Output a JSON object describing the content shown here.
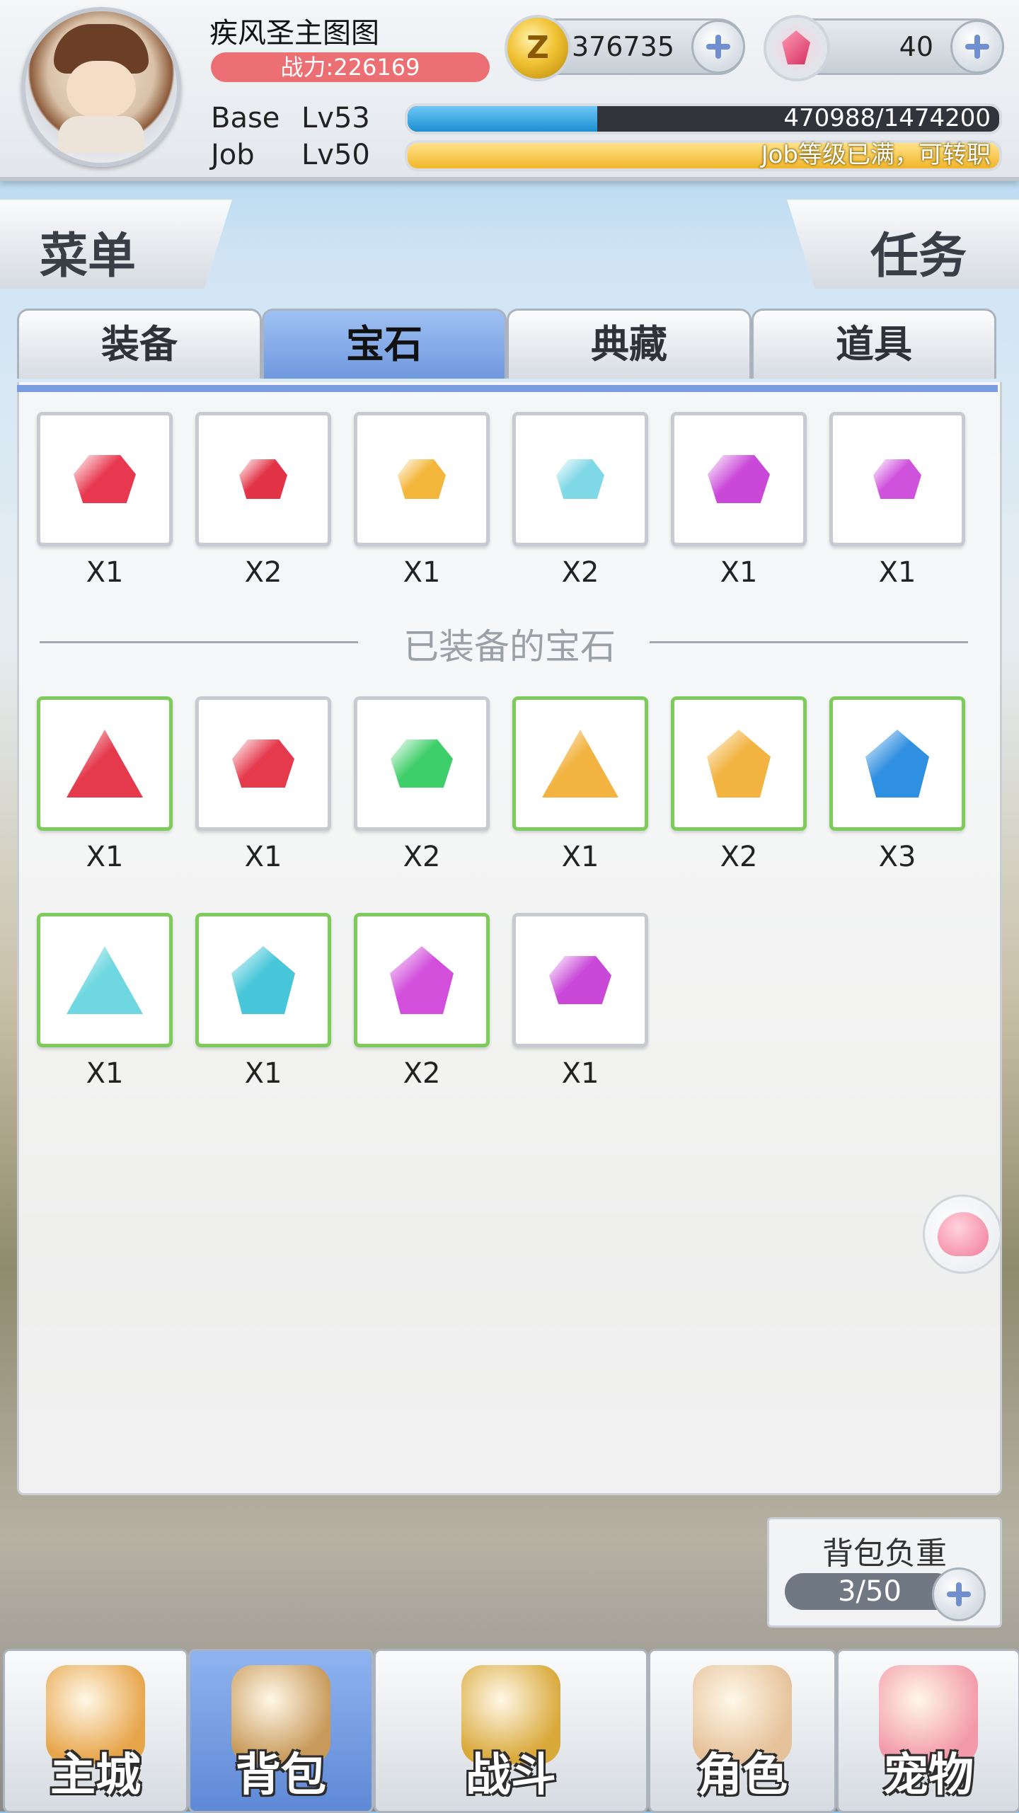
{
  "player": {
    "name": "疾风圣主图图",
    "power": "战力:226169",
    "base_label": "Base",
    "base_level": "Lv53",
    "base_exp": "470988/1474200",
    "base_progress": 0.32,
    "job_label": "Job",
    "job_level": "Lv50",
    "job_status": "Job等级已满，可转职",
    "job_progress": 1.0
  },
  "currency": {
    "zeny_icon_text": "Z",
    "zeny": "376735",
    "gems": "40"
  },
  "buttons": {
    "menu": "菜单",
    "tasks": "任务"
  },
  "tabs": [
    "装备",
    "宝石",
    "典藏",
    "道具"
  ],
  "active_tab": "宝石",
  "inventory_gems": [
    {
      "shape": "oval",
      "color": "#e8384f",
      "count": "X1"
    },
    {
      "shape": "oval-small",
      "color": "#e23446",
      "count": "X2"
    },
    {
      "shape": "oval-small",
      "color": "#f3b63a",
      "count": "X1"
    },
    {
      "shape": "oval-small",
      "color": "#7fd8e6",
      "count": "X2"
    },
    {
      "shape": "oval",
      "color": "#c948d8",
      "count": "X1"
    },
    {
      "shape": "oval-small",
      "color": "#cf52dd",
      "count": "X1"
    }
  ],
  "divider_label": "已装备的宝石",
  "equipped_gems": [
    {
      "shape": "tri",
      "color": "#e53a4c",
      "count": "X1",
      "equipped": true
    },
    {
      "shape": "oval",
      "color": "#e53a4c",
      "count": "X1",
      "equipped": false
    },
    {
      "shape": "oval",
      "color": "#3fcf6a",
      "count": "X2",
      "equipped": false
    },
    {
      "shape": "tri",
      "color": "#f2b340",
      "count": "X1",
      "equipped": true
    },
    {
      "shape": "tri-round",
      "color": "#f2b340",
      "count": "X2",
      "equipped": true
    },
    {
      "shape": "tri-round",
      "color": "#2f8fe0",
      "count": "X3",
      "equipped": true
    },
    {
      "shape": "tri",
      "color": "#6fd7e0",
      "count": "X1",
      "equipped": true
    },
    {
      "shape": "tri-round",
      "color": "#46c6d8",
      "count": "X1",
      "equipped": true
    },
    {
      "shape": "tri-round",
      "color": "#d24fdc",
      "count": "X2",
      "equipped": true
    },
    {
      "shape": "oval",
      "color": "#c948d8",
      "count": "X1",
      "equipped": false
    }
  ],
  "bag": {
    "label": "背包负重",
    "value": "3/50"
  },
  "nav": [
    {
      "label": "主城",
      "icon": "castle-icon",
      "color": "#e7a54a"
    },
    {
      "label": "背包",
      "icon": "backpack-icon",
      "color": "#c89a5a"
    },
    {
      "label": "战斗",
      "icon": "battle-wheel-icon",
      "color": "#d9a93a"
    },
    {
      "label": "角色",
      "icon": "character-icon",
      "color": "#e5c29a"
    },
    {
      "label": "宠物",
      "icon": "pet-icon",
      "color": "#f39aaa"
    }
  ],
  "active_nav": "背包"
}
